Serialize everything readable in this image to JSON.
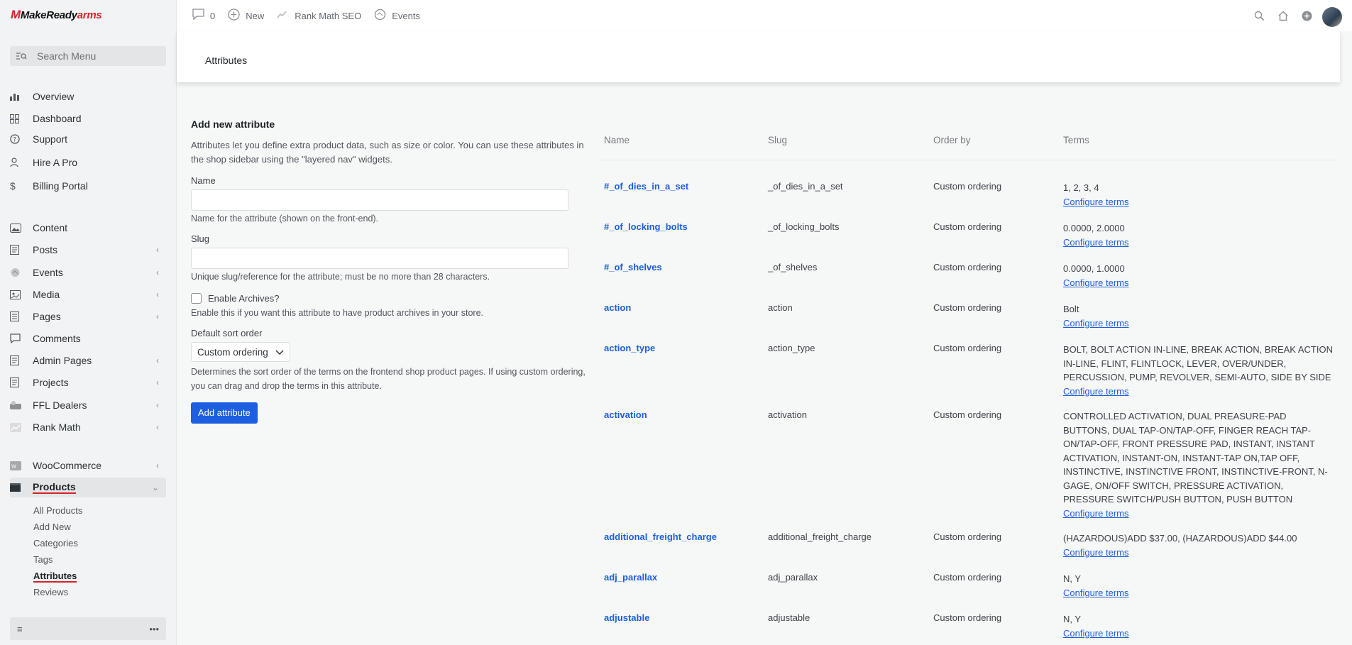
{
  "brand": {
    "logo_text_main": "MakeReady",
    "logo_text_accent": "arms"
  },
  "sidebar": {
    "search_placeholder": "Search Menu",
    "items": [
      {
        "label": "Overview",
        "icon": "bar-chart-icon"
      },
      {
        "label": "Dashboard",
        "icon": "grid-icon"
      },
      {
        "label": "Support",
        "icon": "help-icon"
      },
      {
        "label": "Hire A Pro",
        "icon": "person-icon"
      },
      {
        "label": "Billing Portal",
        "icon": "dollar-icon"
      },
      {
        "label": "Content",
        "icon": "image-icon"
      },
      {
        "label": "Posts",
        "icon": "document-icon"
      },
      {
        "label": "Events",
        "icon": "calendar-icon"
      },
      {
        "label": "Media",
        "icon": "media-icon"
      },
      {
        "label": "Pages",
        "icon": "pages-icon"
      },
      {
        "label": "Comments",
        "icon": "comment-icon"
      },
      {
        "label": "Admin Pages",
        "icon": "document-icon"
      },
      {
        "label": "Projects",
        "icon": "document-icon"
      },
      {
        "label": "FFL Dealers",
        "icon": "dealer-icon"
      },
      {
        "label": "Rank Math",
        "icon": "rankmath-icon"
      },
      {
        "label": "WooCommerce",
        "icon": "woo-icon"
      },
      {
        "label": "Products",
        "icon": "box-icon"
      }
    ],
    "submenu": [
      "All Products",
      "Add New",
      "Categories",
      "Tags",
      "Attributes",
      "Reviews"
    ]
  },
  "topbar": {
    "comments_count": "0",
    "new_label": "New",
    "seo_label": "Rank Math SEO",
    "events_label": "Events"
  },
  "header": {
    "title": "Attributes"
  },
  "form": {
    "heading": "Add new attribute",
    "intro": "Attributes let you define extra product data, such as size or color. You can use these attributes in the shop sidebar using the \"layered nav\" widgets.",
    "name_label": "Name",
    "name_help": "Name for the attribute (shown on the front-end).",
    "slug_label": "Slug",
    "slug_help": "Unique slug/reference for the attribute; must be no more than 28 characters.",
    "archives_label": "Enable Archives?",
    "archives_help": "Enable this if you want this attribute to have product archives in your store.",
    "sort_label": "Default sort order",
    "sort_value": "Custom ordering",
    "sort_help": "Determines the sort order of the terms on the frontend shop product pages. If using custom ordering, you can drag and drop the terms in this attribute.",
    "submit_label": "Add attribute"
  },
  "table": {
    "headers": {
      "name": "Name",
      "slug": "Slug",
      "order": "Order by",
      "terms": "Terms"
    },
    "configure_label": "Configure terms",
    "rows": [
      {
        "name": "#_of_dies_in_a_set",
        "slug": "_of_dies_in_a_set",
        "order": "Custom ordering",
        "terms": "1, 2, 3, 4"
      },
      {
        "name": "#_of_locking_bolts",
        "slug": "_of_locking_bolts",
        "order": "Custom ordering",
        "terms": "0.0000, 2.0000"
      },
      {
        "name": "#_of_shelves",
        "slug": "_of_shelves",
        "order": "Custom ordering",
        "terms": "0.0000, 1.0000"
      },
      {
        "name": "action",
        "slug": "action",
        "order": "Custom ordering",
        "terms": "Bolt"
      },
      {
        "name": "action_type",
        "slug": "action_type",
        "order": "Custom ordering",
        "terms": "BOLT, BOLT ACTION IN-LINE, BREAK ACTION, BREAK ACTION IN-LINE, FLINT, FLINTLOCK, LEVER, OVER/UNDER, PERCUSSION, PUMP, REVOLVER, SEMI-AUTO, SIDE BY SIDE"
      },
      {
        "name": "activation",
        "slug": "activation",
        "order": "Custom ordering",
        "terms": "CONTROLLED ACTIVATION, DUAL PREASURE-PAD BUTTONS, DUAL TAP-ON/TAP-OFF, FINGER REACH TAP-ON/TAP-OFF, FRONT PRESSURE PAD, INSTANT, INSTANT ACTIVATION, INSTANT-ON, INSTANT-TAP ON,TAP OFF, INSTINCTIVE, INSTINCTIVE FRONT, INSTINCTIVE-FRONT, N-GAGE, ON/OFF SWITCH, PRESSURE ACTIVATION, PRESSURE SWITCH/PUSH BUTTON, PUSH BUTTON"
      },
      {
        "name": "additional_freight_charge",
        "slug": "additional_freight_charge",
        "order": "Custom ordering",
        "terms": "(HAZARDOUS)ADD $37.00, (HAZARDOUS)ADD $44.00"
      },
      {
        "name": "adj_parallax",
        "slug": "adj_parallax",
        "order": "Custom ordering",
        "terms": "N, Y"
      },
      {
        "name": "adjustable",
        "slug": "adjustable",
        "order": "Custom ordering",
        "terms": "N, Y"
      }
    ]
  }
}
